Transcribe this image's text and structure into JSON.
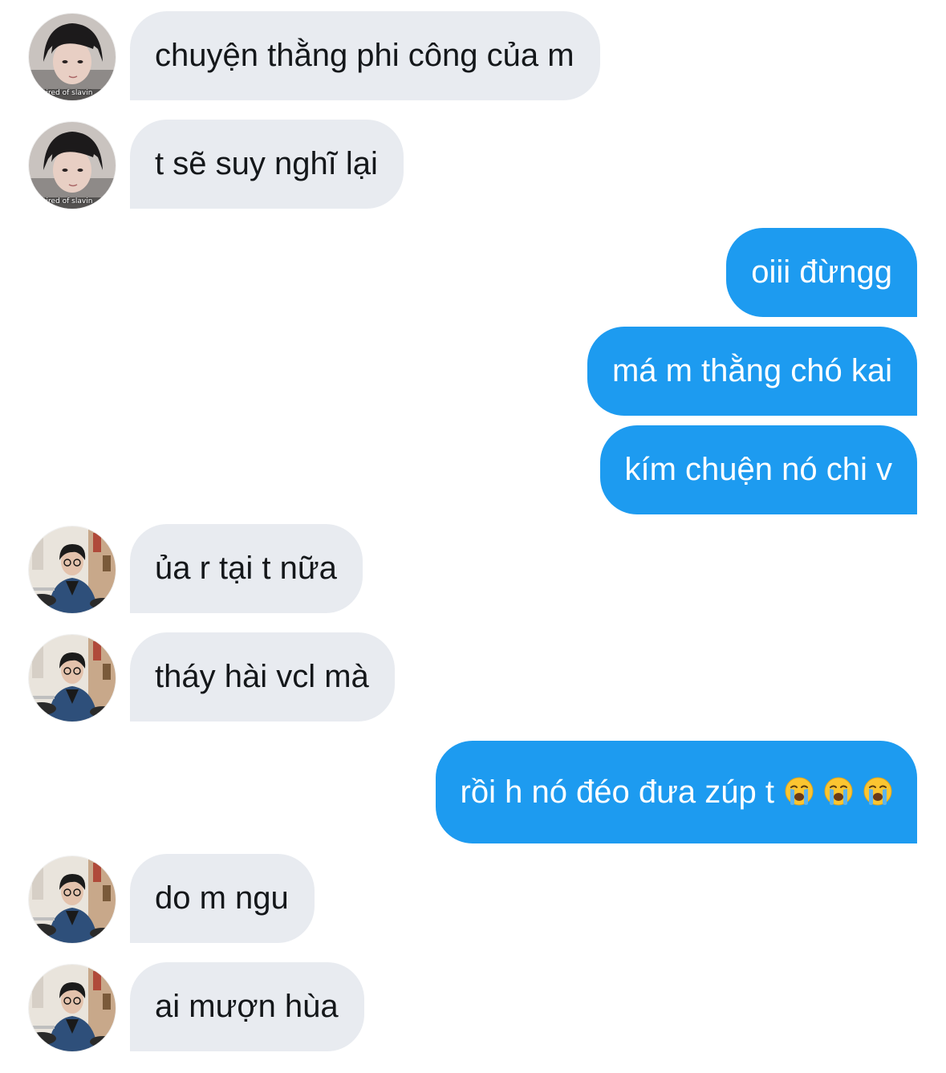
{
  "conversation": {
    "messages": [
      {
        "direction": "in",
        "text": "chuyện thằng phi công của m",
        "avatar": "avatar-a"
      },
      {
        "direction": "in",
        "text": "t sẽ suy nghĩ lại",
        "avatar": "avatar-a"
      },
      {
        "direction": "out",
        "text": "oiii đừngg"
      },
      {
        "direction": "out",
        "text": "má m thằng chó kai"
      },
      {
        "direction": "out",
        "text": "kím chuện nó chi v"
      },
      {
        "direction": "in",
        "text": "ủa r tại t nữa",
        "avatar": "avatar-b"
      },
      {
        "direction": "in",
        "text": "tháy hài vcl mà",
        "avatar": "avatar-b"
      },
      {
        "direction": "out",
        "text": "rồi h nó đéo đưa zúp t",
        "emojis": [
          "crying-face-icon",
          "crying-face-icon",
          "crying-face-icon"
        ]
      },
      {
        "direction": "in",
        "text": "do m ngu",
        "avatar": "avatar-b"
      },
      {
        "direction": "in",
        "text": "ai mượn hùa",
        "avatar": "avatar-b"
      }
    ],
    "avatar_caption": "tired of slavin"
  },
  "colors": {
    "incoming_bubble": "#e8ebf0",
    "incoming_text": "#14171a",
    "outgoing_bubble": "#1d9bf0",
    "outgoing_text": "#ffffff",
    "background": "#ffffff"
  }
}
